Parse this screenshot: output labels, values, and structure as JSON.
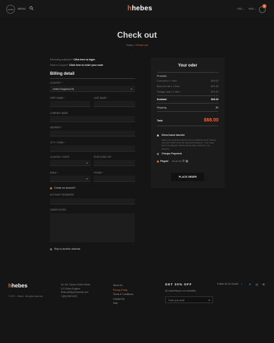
{
  "header": {
    "menu_circle": "KASS",
    "menu_label": "MENU",
    "logo_main": "hebes",
    "currency": "USD ⌄",
    "language": "ENG ⌄",
    "cart_count": "0"
  },
  "hero": {
    "title": "Check out",
    "crumb_home": "Home",
    "crumb_sep": "»",
    "crumb_current": "Check out"
  },
  "notice": {
    "returning_text": "Returning customer?",
    "returning_link": "Click here to login",
    "coupon_text": "Have a Coupon?",
    "coupon_link": "Click here to enter your code"
  },
  "billing": {
    "title": "Billing detail",
    "country_label": "COUNTRY *",
    "country_value": "United Kingdom(UK)",
    "first_name_label": "FIRST NAME *",
    "last_name_label": "LAST NAME *",
    "company_label": "COMPANY NAME",
    "address_label": "ADDRESS *",
    "city_label": "CITY / TOWN *",
    "county_label": "COUNTRY / STATE",
    "postcode_label": "POSTCODE / ZIP",
    "email_label": "EMAIL *",
    "phone_label": "PHONE *",
    "create_account_label": "Create an account?",
    "account_password_label": "ACCOUNT PASSWORD",
    "order_notes_label": "ORDER NOTES",
    "ship_diff_label": "Ship to another address"
  },
  "order": {
    "title": "Your oder",
    "products_label": "Products",
    "products": [
      {
        "name": "Cool sock x 1 item",
        "price": "$28.00"
      },
      {
        "name": "Boho art cat x 1 item",
        "price": "$20.00"
      },
      {
        "name": "Vintage coat x 1 item",
        "price": "$20.00"
      }
    ],
    "subtotal_label": "Subtotal",
    "subtotal_value": "$68.00",
    "shipping_label": "Shipping",
    "shipping_value": "$0",
    "total_label": "Total",
    "total_value": "$68.00",
    "bank_transfer_label": "Direct bank transfer",
    "bank_transfer_text": "Make your payment directly into our bank account. Please use your Order ID as the payment reference. Your order won't be shipped until the funds have cleared in our account.",
    "cheque_label": "Cheque Payment",
    "paypal_label": "Paypal",
    "place_order_label": "PLACE ORDER"
  },
  "footer": {
    "logo_main": "hebes",
    "copyright": "© 2017 - Hebes . All rights reserved",
    "address_lines": [
      "No 340, Garden Oxford Street,",
      "CO Oxford England",
      "Bestcode@yourdomain.com",
      "+(84) 2050 3200"
    ],
    "links": [
      "About Us",
      "Privacy Policy",
      "Terms & Conditions",
      "Contact Us",
      "Help"
    ],
    "active_link_index": 1,
    "get_offer": "GET 20% OFF",
    "subscribe_text": "By subscribing to our newsletter",
    "email_placeholder": "Enter your email",
    "follow_label": "Follow Us On Social"
  },
  "colors": {
    "accent": "#e8673a",
    "background": "#151515",
    "card": "#1b1b1b"
  }
}
